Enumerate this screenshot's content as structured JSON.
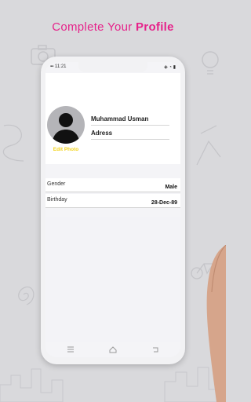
{
  "headline": {
    "text_normal": "Complete Your ",
    "text_bold": "Profile"
  },
  "status_bar": {
    "time": "11:21",
    "right_icons": "◈ ◔ ▮"
  },
  "profile": {
    "edit_photo_label": "Edit Photo",
    "name": "Muhammad Usman",
    "address": "Adress"
  },
  "fields": [
    {
      "label": "Gender",
      "value": "Male"
    },
    {
      "label": "Birthday",
      "value": "28-Dec-89"
    }
  ],
  "nav_icons": [
    "menu-icon",
    "home-icon",
    "back-icon"
  ],
  "colors": {
    "accent_pink": "#e6228a",
    "edit_photo_yellow": "#f2d31a",
    "background": "#d9d9dc"
  }
}
